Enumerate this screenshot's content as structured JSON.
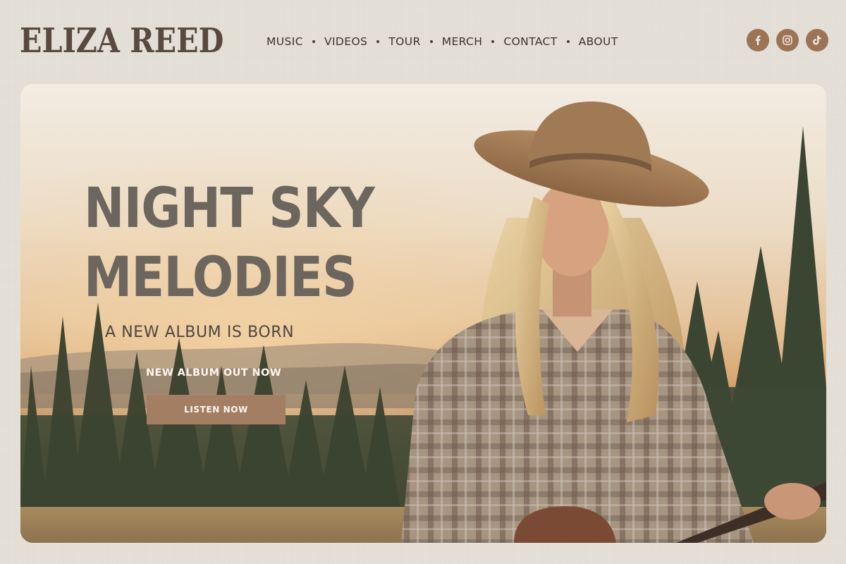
{
  "brand": {
    "name": "ELIZA REED"
  },
  "nav": {
    "items": [
      {
        "label": "MUSIC"
      },
      {
        "label": "VIDEOS"
      },
      {
        "label": "TOUR"
      },
      {
        "label": "MERCH"
      },
      {
        "label": "CONTACT"
      },
      {
        "label": "ABOUT"
      }
    ]
  },
  "socials": [
    {
      "icon": "facebook-icon"
    },
    {
      "icon": "instagram-icon"
    },
    {
      "icon": "tiktok-icon"
    }
  ],
  "hero": {
    "title_line1": "NIGHT SKY",
    "title_line2": "MELODIES",
    "subtitle": "A NEW ALBUM IS BORN",
    "note": "NEW ALBUM OUT NOW",
    "cta_label": "LISTEN NOW"
  },
  "colors": {
    "background": "#e6e1d9",
    "brand": "#594a3f",
    "accent": "#a47e63",
    "social_bg": "#9b7457",
    "title": "#6d665f"
  }
}
